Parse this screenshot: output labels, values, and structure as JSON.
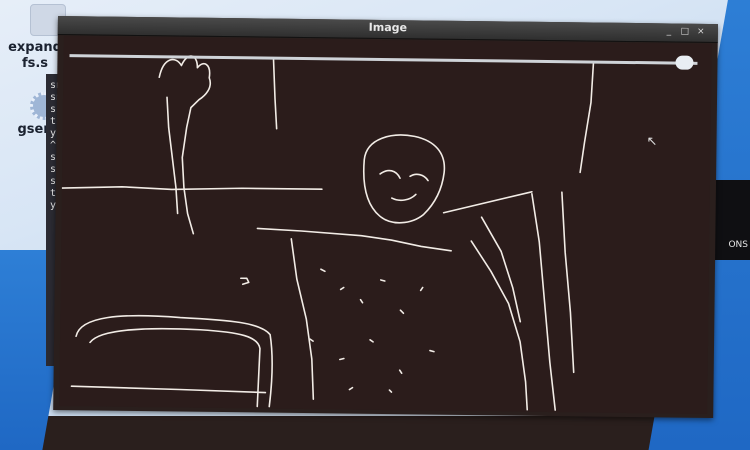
{
  "desktop": {
    "icon1_label": "expand",
    "icon1_sub": "fs.s",
    "icon2_label": "gsen",
    "right_strip_text": "ONS"
  },
  "terminal": {
    "text": "snsnst:.:yZ^rsnsnst:.:yZ"
  },
  "window": {
    "title": "Image",
    "buttons": [
      "_",
      "□",
      "×"
    ],
    "trackbar_value": 1.0
  },
  "colors": {
    "canvas_bg": "#2b1c1b",
    "edge_color": "#f2ece6",
    "titlebar": "#3a3a3a"
  }
}
